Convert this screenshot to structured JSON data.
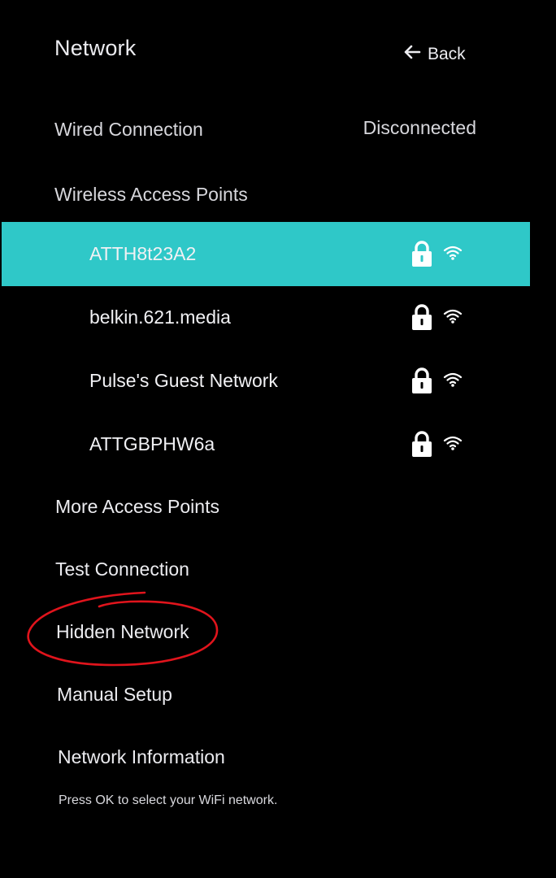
{
  "header": {
    "title": "Network",
    "back_label": "Back"
  },
  "wired": {
    "label": "Wired Connection",
    "status": "Disconnected"
  },
  "wireless": {
    "section_label": "Wireless Access Points",
    "access_points": [
      {
        "name": "ATTH8t23A2",
        "selected": true,
        "secured": true,
        "icon": "wifi-icon"
      },
      {
        "name": "belkin.621.media",
        "selected": false,
        "secured": true,
        "icon": "wifi-icon"
      },
      {
        "name": "Pulse's Guest Network",
        "selected": false,
        "secured": true,
        "icon": "wifi-icon"
      },
      {
        "name": "ATTGBPHW6a",
        "selected": false,
        "secured": true,
        "icon": "wifi-icon"
      }
    ]
  },
  "menu": {
    "more_access_points": "More Access Points",
    "test_connection": "Test Connection",
    "hidden_network": "Hidden Network",
    "manual_setup": "Manual Setup",
    "network_information": "Network Information"
  },
  "hint": "Press OK to select your WiFi network.",
  "colors": {
    "background": "#000000",
    "selection": "#2fc8c8",
    "annotation": "#e0141c",
    "text": "#ececf0"
  }
}
